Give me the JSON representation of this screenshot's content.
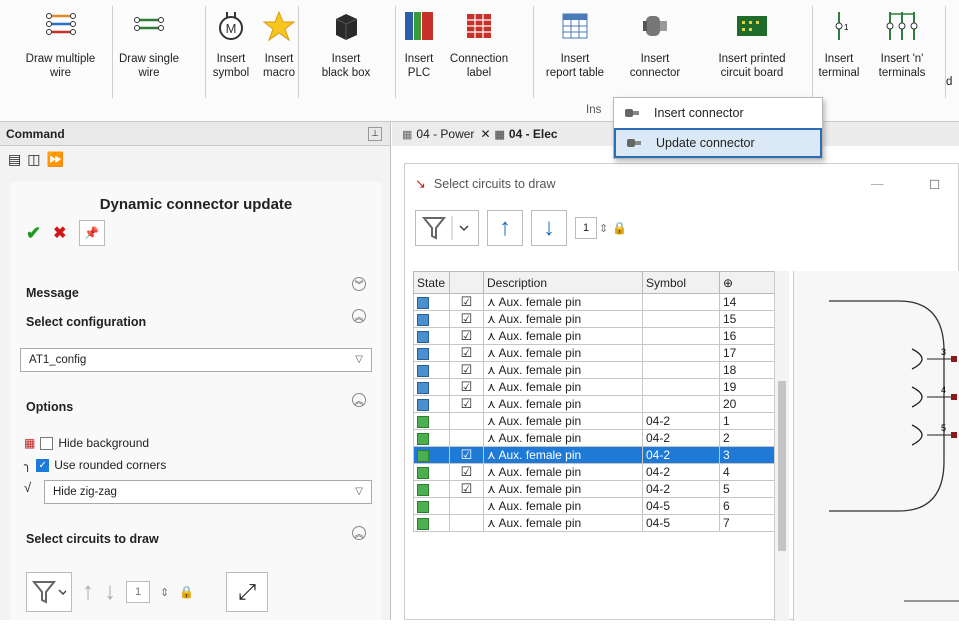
{
  "ribbon": {
    "buttons": [
      {
        "label": "Draw multiple\nwire",
        "icon": "multi-wire-icon"
      },
      {
        "label": "Draw single\nwire",
        "icon": "single-wire-icon"
      },
      {
        "label": "Insert\nsymbol",
        "icon": "motor-symbol-icon"
      },
      {
        "label": "Insert\nmacro",
        "icon": "star-icon"
      },
      {
        "label": "Insert\nblack box",
        "icon": "black-box-icon"
      },
      {
        "label": "Insert\nPLC",
        "icon": "plc-icon"
      },
      {
        "label": "Connection\nlabel",
        "icon": "connection-label-icon"
      },
      {
        "label": "Insert\nreport table",
        "icon": "report-table-icon"
      },
      {
        "label": "Insert\nconnector",
        "icon": "connector-icon"
      },
      {
        "label": "Insert printed\ncircuit board",
        "icon": "pcb-icon"
      },
      {
        "label": "Insert\nterminal",
        "icon": "terminal-icon"
      },
      {
        "label": "Insert 'n'\nterminals",
        "icon": "n-terminals-icon"
      }
    ],
    "group_label": "Ins",
    "overflow_label": "d"
  },
  "connector_menu": {
    "items": [
      "Insert connector",
      "Update connector"
    ]
  },
  "command_panel": {
    "title": "Command",
    "heading": "Dynamic connector update",
    "message_label": "Message",
    "select_configuration_label": "Select configuration",
    "configuration_value": "AT1_config",
    "options_label": "Options",
    "hide_background": "Hide background",
    "use_rounded_corners": "Use rounded corners",
    "zigzag_value": "Hide zig-zag",
    "select_circuits_label": "Select circuits to draw",
    "spin_value": "1"
  },
  "tabs": [
    {
      "label": "04 - Power"
    },
    {
      "label": "04 - Elec"
    }
  ],
  "draw_window": {
    "title": "Select circuits to draw",
    "spin_value": "1",
    "columns": [
      "State",
      "",
      "Description",
      "Symbol",
      "⊕"
    ],
    "rows": [
      {
        "state": "blue",
        "checked": true,
        "description": "Aux. female pin",
        "symbol": "",
        "num": "14"
      },
      {
        "state": "blue",
        "checked": true,
        "description": "Aux. female pin",
        "symbol": "",
        "num": "15"
      },
      {
        "state": "blue",
        "checked": true,
        "description": "Aux. female pin",
        "symbol": "",
        "num": "16"
      },
      {
        "state": "blue",
        "checked": true,
        "description": "Aux. female pin",
        "symbol": "",
        "num": "17"
      },
      {
        "state": "blue",
        "checked": true,
        "description": "Aux. female pin",
        "symbol": "",
        "num": "18"
      },
      {
        "state": "blue",
        "checked": true,
        "description": "Aux. female pin",
        "symbol": "",
        "num": "19"
      },
      {
        "state": "blue",
        "checked": true,
        "description": "Aux. female pin",
        "symbol": "",
        "num": "20"
      },
      {
        "state": "green",
        "checked": false,
        "description": "Aux. female pin",
        "symbol": "04-2",
        "num": "1"
      },
      {
        "state": "green",
        "checked": false,
        "description": "Aux. female pin",
        "symbol": "04-2",
        "num": "2"
      },
      {
        "state": "green",
        "checked": true,
        "description": "Aux. female pin",
        "symbol": "04-2",
        "num": "3",
        "selected": true
      },
      {
        "state": "green",
        "checked": true,
        "description": "Aux. female pin",
        "symbol": "04-2",
        "num": "4"
      },
      {
        "state": "green",
        "checked": true,
        "description": "Aux. female pin",
        "symbol": "04-2",
        "num": "5"
      },
      {
        "state": "green",
        "checked": false,
        "description": "Aux. female pin",
        "symbol": "04-5",
        "num": "6"
      },
      {
        "state": "green",
        "checked": false,
        "description": "Aux. female pin",
        "symbol": "04-5",
        "num": "7"
      }
    ],
    "preview_pins": [
      "3",
      "4",
      "5"
    ]
  }
}
